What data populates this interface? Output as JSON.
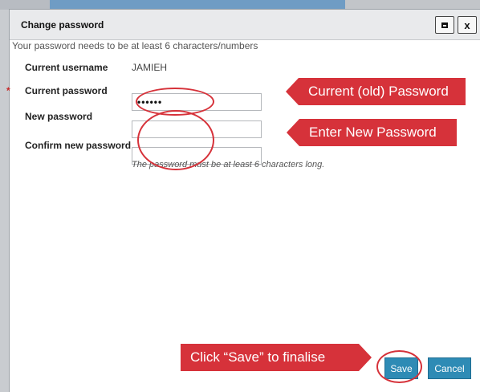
{
  "window": {
    "title": "Change password",
    "maximize_icon": "maximize-icon",
    "close_label": "x"
  },
  "form": {
    "hint": "Your password needs to be at least 6 characters/numbers",
    "required_mark": "*",
    "username_label": "Current username",
    "username_value": "JAMIEH",
    "current_password_label": "Current password",
    "current_password_value": "123456",
    "new_password_label": "New password",
    "new_password_value": "",
    "confirm_password_label": "Confirm new password",
    "confirm_password_value": "",
    "length_note": "The password must be at least 6 characters long."
  },
  "annotations": {
    "current_old": "Current (old) Password",
    "enter_new": "Enter New Password",
    "click_save": "Click “Save” to finalise"
  },
  "buttons": {
    "save": "Save",
    "cancel": "Cancel"
  },
  "colors": {
    "accent": "#2e8bb5",
    "annotation": "#d6323a"
  }
}
